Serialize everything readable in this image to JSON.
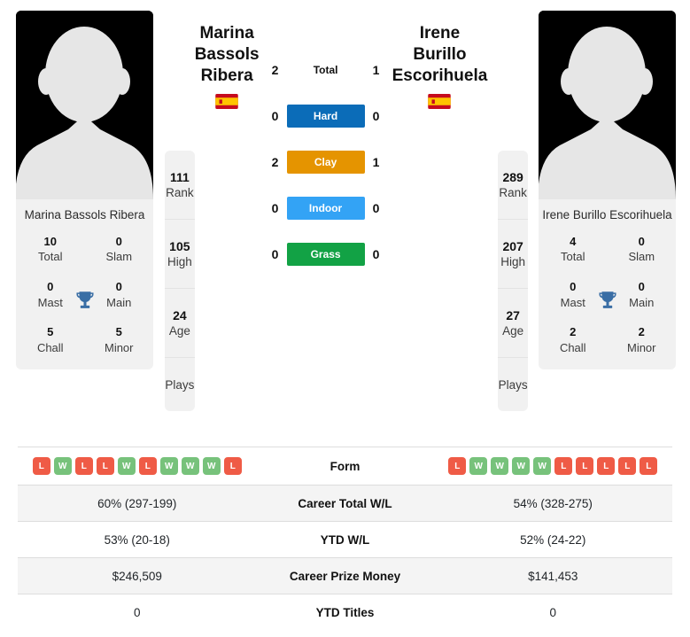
{
  "players": {
    "left": {
      "first_line": "Marina",
      "second_line": "Bassols Ribera",
      "full_name": "Marina Bassols Ribera",
      "flag": "spain-flag",
      "avatar": "player-silhouette-placeholder",
      "titles": {
        "total_value": "10",
        "total_label": "Total",
        "slam_value": "0",
        "slam_label": "Slam",
        "mast_value": "0",
        "mast_label": "Mast",
        "main_value": "0",
        "main_label": "Main",
        "chall_value": "5",
        "chall_label": "Chall",
        "minor_value": "5",
        "minor_label": "Minor"
      },
      "rank_card": [
        {
          "value": "111",
          "label": "Rank"
        },
        {
          "value": "105",
          "label": "High"
        },
        {
          "value": "24",
          "label": "Age"
        },
        {
          "value": "",
          "label": "Plays"
        }
      ],
      "form": [
        "L",
        "W",
        "L",
        "L",
        "W",
        "L",
        "W",
        "W",
        "W",
        "L"
      ]
    },
    "right": {
      "first_line": "Irene Burillo",
      "second_line": "Escorihuela",
      "full_name": "Irene Burillo Escorihuela",
      "flag": "spain-flag",
      "avatar": "player-silhouette-placeholder",
      "titles": {
        "total_value": "4",
        "total_label": "Total",
        "slam_value": "0",
        "slam_label": "Slam",
        "mast_value": "0",
        "mast_label": "Mast",
        "main_value": "0",
        "main_label": "Main",
        "chall_value": "2",
        "chall_label": "Chall",
        "minor_value": "2",
        "minor_label": "Minor"
      },
      "rank_card": [
        {
          "value": "289",
          "label": "Rank"
        },
        {
          "value": "207",
          "label": "High"
        },
        {
          "value": "27",
          "label": "Age"
        },
        {
          "value": "",
          "label": "Plays"
        }
      ],
      "form": [
        "L",
        "W",
        "W",
        "W",
        "W",
        "L",
        "L",
        "L",
        "L",
        "L"
      ]
    }
  },
  "h2h": {
    "total": {
      "label": "Total",
      "left": "2",
      "right": "1"
    },
    "surfaces": [
      {
        "label": "Hard",
        "left": "0",
        "right": "0",
        "color": "#0b6cb8"
      },
      {
        "label": "Clay",
        "left": "2",
        "right": "1",
        "color": "#e59400"
      },
      {
        "label": "Indoor",
        "left": "0",
        "right": "0",
        "color": "#33a3f5"
      },
      {
        "label": "Grass",
        "left": "0",
        "right": "0",
        "color": "#12a245"
      }
    ]
  },
  "stats_rows": [
    {
      "label": "Form",
      "left": "",
      "right": ""
    },
    {
      "label": "Career Total W/L",
      "left": "60% (297-199)",
      "right": "54% (328-275)"
    },
    {
      "label": "YTD W/L",
      "left": "53% (20-18)",
      "right": "52% (24-22)"
    },
    {
      "label": "Career Prize Money",
      "left": "$246,509",
      "right": "$141,453"
    },
    {
      "label": "YTD Titles",
      "left": "0",
      "right": "0"
    }
  ],
  "colors": {
    "win": "#77c27b",
    "loss": "#ef5b46",
    "trophy": "#3a6ea5",
    "card_bg": "#f1f1f1",
    "row_alt": "#f4f4f4"
  }
}
